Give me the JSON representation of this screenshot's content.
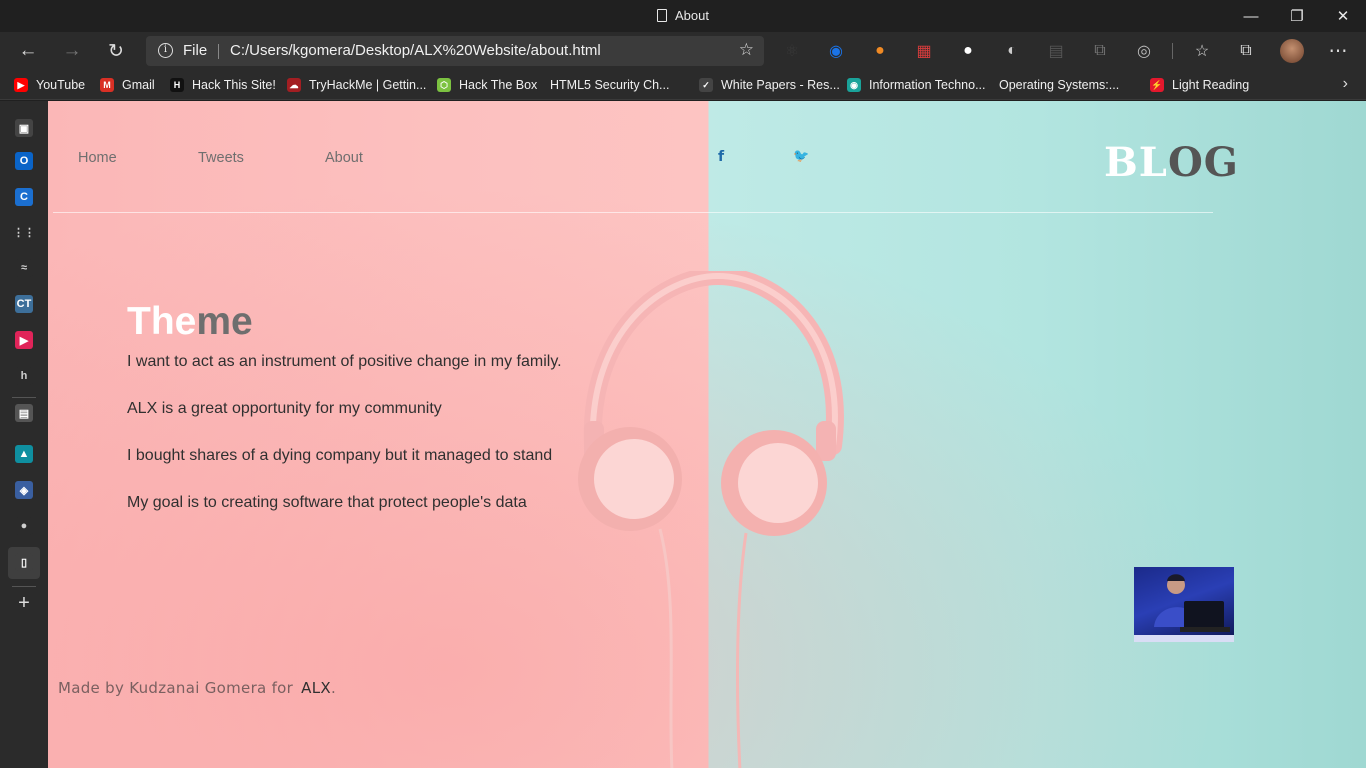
{
  "window": {
    "title": "About",
    "controls": {
      "minimize": "—",
      "restore": "❐",
      "close": "✕"
    }
  },
  "toolbar": {
    "back": "←",
    "forward": "→",
    "refresh": "↻",
    "address": {
      "info": "i",
      "protocol": "File",
      "url": "C:/Users/kgomera/Desktop/ALX%20Website/about.html",
      "favorite_icon": "☆"
    },
    "more": "⋯",
    "extensions": [
      {
        "name": "react-icon",
        "glyph": "⚛",
        "color": "#3a3a3a"
      },
      {
        "name": "share-icon",
        "glyph": "◉",
        "color": "#1a73e8"
      },
      {
        "name": "ext-orange-icon",
        "glyph": "●",
        "color": "#f08a24"
      },
      {
        "name": "ext-grid-icon",
        "glyph": "▦",
        "color": "#d63c3c"
      },
      {
        "name": "github-icon",
        "glyph": "●",
        "color": "#ffffff"
      },
      {
        "name": "ext-ghost-icon",
        "glyph": "◐",
        "color": "#cccccc"
      },
      {
        "name": "ext-dark-icon",
        "glyph": "▤",
        "color": "#555555"
      },
      {
        "name": "ext-pages-icon",
        "glyph": "⧉",
        "color": "#777777"
      },
      {
        "name": "ext-target-icon",
        "glyph": "◎",
        "color": "#bbbbbb"
      },
      {
        "name": "favorites-icon",
        "glyph": "☆",
        "color": "#dddddd"
      },
      {
        "name": "collections-icon",
        "glyph": "⧉",
        "color": "#dddddd"
      }
    ]
  },
  "favorites": [
    {
      "label": "YouTube",
      "icon": "▶",
      "color": "#ff0000"
    },
    {
      "label": "Gmail",
      "icon": "M",
      "color": "#d93025"
    },
    {
      "label": "Hack This Site!",
      "icon": "H",
      "color": "#111111"
    },
    {
      "label": "TryHackMe | Gettin...",
      "icon": "☁",
      "color": "#a31e22"
    },
    {
      "label": "Hack The Box",
      "icon": "⬡",
      "color": "#7cc241"
    },
    {
      "label": "HTML5 Security Ch...",
      "icon": "",
      "color": "page"
    },
    {
      "label": "White Papers - Res...",
      "icon": "✓",
      "color": "#444444"
    },
    {
      "label": "Information Techno...",
      "icon": "◉",
      "color": "#1aa39a"
    },
    {
      "label": "Operating Systems:...",
      "icon": "",
      "color": "page"
    },
    {
      "label": "Light Reading",
      "icon": "⚡",
      "color": "#e3182d"
    }
  ],
  "favorites_more": "›",
  "sidebar": [
    {
      "name": "sidebar-news-icon",
      "glyph": "▣",
      "color": "#444444"
    },
    {
      "name": "sidebar-outlook-icon",
      "glyph": "O",
      "color": "#0a64c8"
    },
    {
      "name": "sidebar-c-icon",
      "glyph": "C",
      "color": "#1b6fd0"
    },
    {
      "name": "sidebar-cisco-icon",
      "glyph": "⋮⋮",
      "color": "#2b2b2b"
    },
    {
      "name": "sidebar-ab-icon",
      "glyph": "≈",
      "color": "#2b2b2b"
    },
    {
      "name": "sidebar-ct-icon",
      "glyph": "CT",
      "color": "#3d6f9a"
    },
    {
      "name": "sidebar-media-icon",
      "glyph": "▶",
      "color": "#e02459"
    },
    {
      "name": "sidebar-h-icon",
      "glyph": "h",
      "color": "#2b2b2b"
    },
    {
      "name": "sidebar-book-icon",
      "glyph": "▤",
      "color": "#555555"
    },
    {
      "name": "sidebar-arrow-icon",
      "glyph": "▲",
      "color": "#0f8fa0"
    },
    {
      "name": "sidebar-stack-icon",
      "glyph": "◈",
      "color": "#3a5fa0"
    },
    {
      "name": "sidebar-github-icon",
      "glyph": "●",
      "color": "#2b2b2b"
    },
    {
      "name": "sidebar-page-icon",
      "glyph": "▯",
      "color": "#3f3f3f"
    }
  ],
  "sidebar_add": "+",
  "site": {
    "nav": [
      "Home",
      "Tweets",
      "About"
    ],
    "social": {
      "facebook": "f",
      "twitter": "🐦"
    },
    "logo": {
      "part1": "BL",
      "part2": "OG"
    },
    "heading": {
      "part1": "The",
      "part2": "me"
    },
    "paragraphs": [
      "I want to act as an instrument of positive change in my family.",
      "ALX is a great opportunity for my community",
      "I bought shares of a dying company but it managed to stand",
      "My goal is to creating software that protect people's data"
    ],
    "footer": {
      "text": "Made by Kudzanai Gomera for",
      "link": "ALX",
      "end": "."
    }
  }
}
